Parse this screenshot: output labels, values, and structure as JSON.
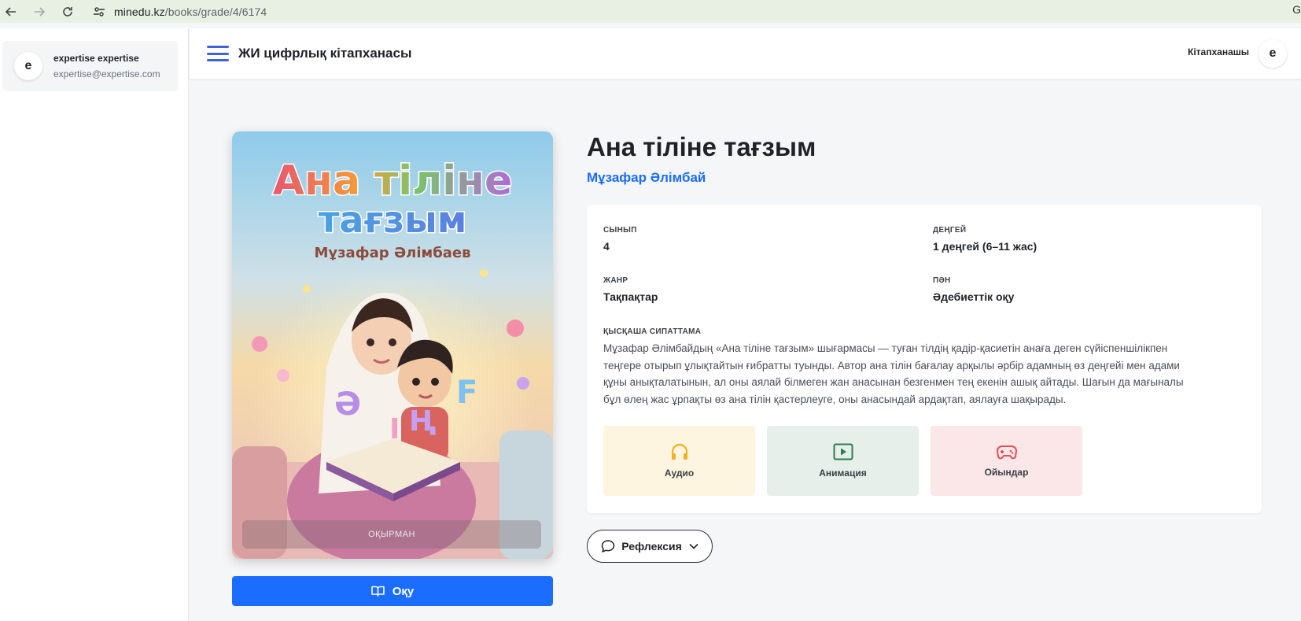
{
  "browser": {
    "url_host": "minedu.kz",
    "url_path": "/books/grade/4/6174",
    "edge_glyph": "G"
  },
  "sidebar": {
    "user_initial": "e",
    "user_name": "expertise expertise",
    "user_email": "expertise@expertise.com"
  },
  "header": {
    "app_title": "ЖИ цифрлық кітапханасы",
    "role": "Кітапханашы",
    "avatar_initial": "e"
  },
  "book": {
    "title": "Ана тіліне тағзым",
    "author": "Мұзафар Әлімбай",
    "cover": {
      "title_line1": "Ана тіліне",
      "title_line2": "тағзым",
      "author": "Мұзафар Әлімбаев",
      "letters": [
        "Ә",
        "І",
        "Ң",
        "F"
      ],
      "badge": "ОҚЫРМАН"
    },
    "read_button": "Оқу",
    "meta": {
      "grade_label": "СЫНЫП",
      "grade_value": "4",
      "level_label": "ДЕҢГЕЙ",
      "level_value": "1 деңгей (6–11 жас)",
      "genre_label": "ЖАНР",
      "genre_value": "Тақпақтар",
      "subject_label": "ПӘН",
      "subject_value": "Әдебиеттік оқу",
      "desc_label": "ҚЫСҚАША СИПАТТАМА",
      "desc_line1": "Мұзафар Әлімбайдың «Ана тіліне тағзым» шығармасы — туған тілдің қадір-қасиетін анаға деген сүйіспеншілікпен",
      "desc_line2": "теңгере отырып ұлықтайтын ғибратты туынды. Автор ана тілін бағалау арқылы әрбір адамның өз деңгейі мен адами",
      "desc_line3": "құны анықталатынын, ал оны аялай білмеген жан анасынан безгенмен тең екенін ашық айтады. Шағын да мағыналы",
      "desc_line4": "бұл өлең жас ұрпақты өз ана тілін қастерлеуге, оны анасындай ардақтап, аялауға шақырады."
    },
    "media": {
      "audio": "Аудио",
      "animation": "Анимация",
      "games": "Ойындар"
    },
    "reflection_button": "Рефлексия"
  },
  "icons": {
    "audio": "headphones-icon",
    "animation": "play-icon",
    "games": "gamepad-icon",
    "read": "book-open-icon",
    "reflection": "chat-bubble-icon"
  },
  "colors": {
    "accent": "#1a6dff",
    "hamburger": "#3f63d6",
    "audio_tile": "#fdf5df",
    "animation_tile": "#e6efe9",
    "games_tile": "#fbe6e8",
    "audio_icon": "#f2b01e",
    "animation_icon": "#2e7d4f",
    "games_icon": "#e0505c"
  }
}
